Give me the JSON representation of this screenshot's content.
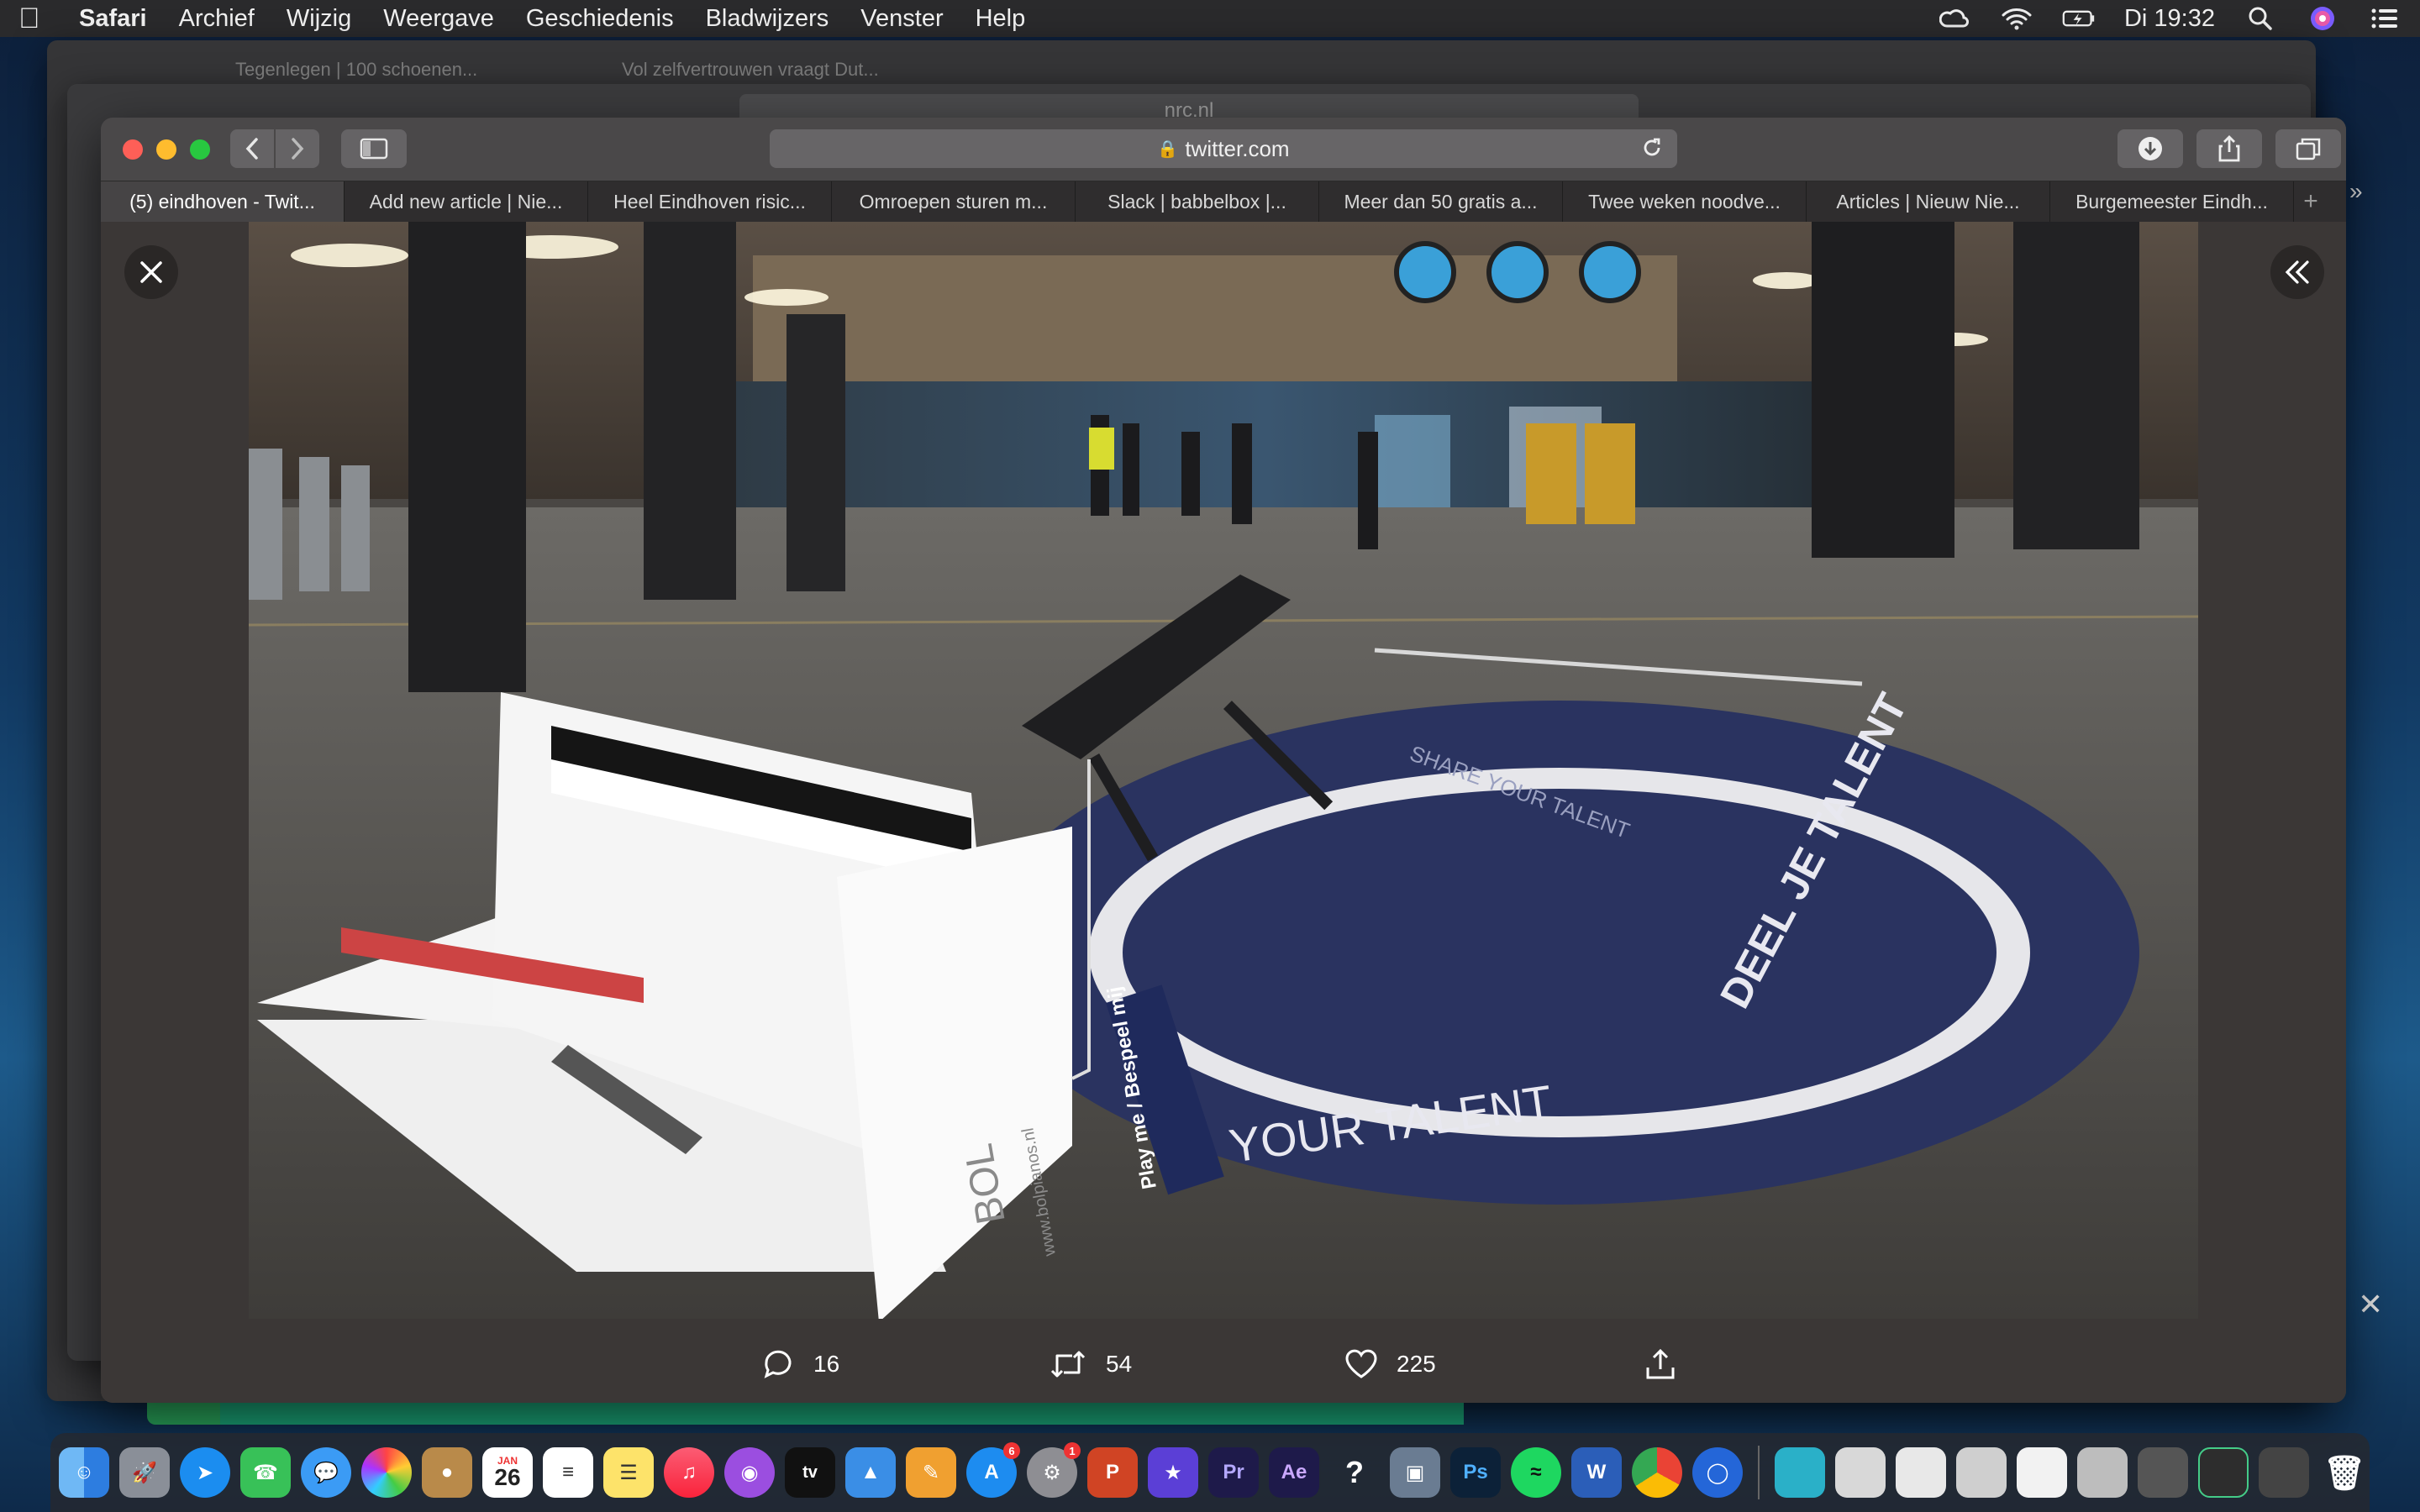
{
  "menubar": {
    "app": "Safari",
    "items": [
      "Archief",
      "Wijzig",
      "Weergave",
      "Geschiedenis",
      "Bladwijzers",
      "Venster",
      "Help"
    ],
    "clock": "Di 19:32"
  },
  "background": {
    "tab1": "Tegenlegen | 100 schoenen...",
    "tab2": "Vol zelfvertrouwen vraagt Dut...",
    "address": "nrc.nl"
  },
  "safari": {
    "address": "twitter.com",
    "tabs": [
      "(5) eindhoven - Twit...",
      "Add new article | Nie...",
      "Heel Eindhoven risic...",
      "Omroepen sturen m...",
      "Slack | babbelbox |...",
      "Meer dan 50 gratis a...",
      "Twee weken noodve...",
      "Articles | Nieuw Nie...",
      "Burgemeester Eindh..."
    ]
  },
  "tweet_actions": {
    "replies": "16",
    "retweets": "54",
    "likes": "225"
  },
  "photo": {
    "floor_text_1": "YOUR TALENT",
    "floor_text_2": "DEEL JE TALENT",
    "floor_text_3": "SHARE YOUR TALENT",
    "piano_sign": "Play me / Bespeel mij",
    "piano_brand": "BOL",
    "piano_url": "www.bolpianos.nl"
  },
  "dock": {
    "calendar_month": "JAN",
    "calendar_day": "26",
    "labels": [
      "Pr",
      "Ae",
      "Ps",
      "W",
      "P"
    ]
  }
}
